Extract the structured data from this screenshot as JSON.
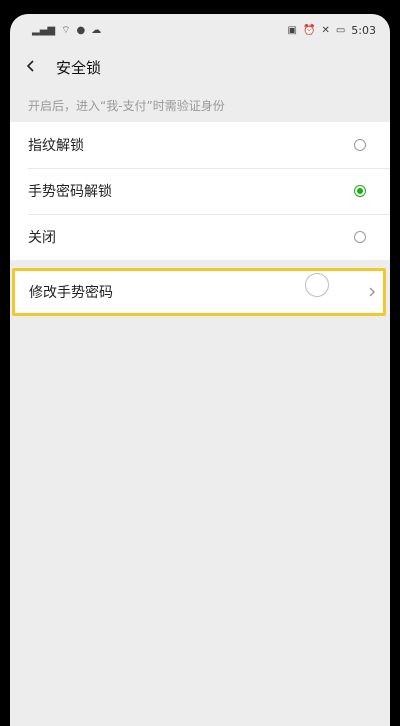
{
  "status_bar": {
    "left_icons": [
      "signal-icon",
      "wifi-icon",
      "notification-icon",
      "cloud-icon"
    ],
    "right_icons": [
      "vibrate-icon",
      "alarm-icon",
      "mute-icon",
      "battery-icon"
    ],
    "time": "5:03"
  },
  "navbar": {
    "back_icon": "chevron-left-icon",
    "title": "安全锁"
  },
  "hint_text": "开启后，进入“我-支付”时需验证身份",
  "options": [
    {
      "label": "指纹解锁",
      "selected": false
    },
    {
      "label": "手势密码解锁",
      "selected": true
    },
    {
      "label": "关闭",
      "selected": false
    }
  ],
  "modify_row": {
    "label": "修改手势密码",
    "chevron_icon": "chevron-right-icon"
  },
  "colors": {
    "accent": "#1aad19",
    "highlight_border": "#f2c82c",
    "background": "#ededed"
  }
}
